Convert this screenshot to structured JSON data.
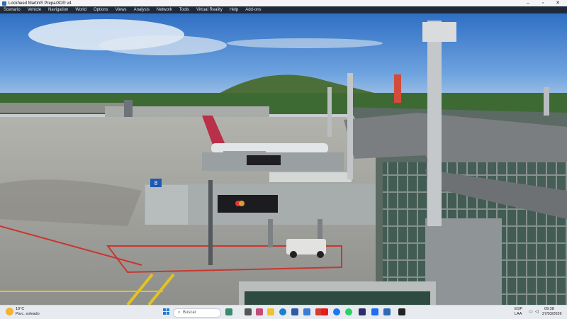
{
  "window": {
    "title": "Lockheed Martin® Prepar3D® v4"
  },
  "menu": [
    "Scenario",
    "Vehicle",
    "Navigation",
    "World",
    "Options",
    "Views",
    "Analysis",
    "Network",
    "Tools",
    "Virtual Reality",
    "Help",
    "Add-ons"
  ],
  "scene": {
    "jetbridge_gate_number": "8",
    "jetbridge_ad_text": "priceless\nBrand Pay"
  },
  "taskbar": {
    "weather_temp": "19°C",
    "weather_desc": "Parc. soleado",
    "search_placeholder": "Buscar",
    "lang_line1": "ESP",
    "lang_line2": "LAA",
    "time": "09:38",
    "date": "27/03/2026"
  },
  "colors": {
    "menubar": "#1d2a3a",
    "sky_top": "#2f6fc4",
    "apron": "#9c9d99"
  }
}
